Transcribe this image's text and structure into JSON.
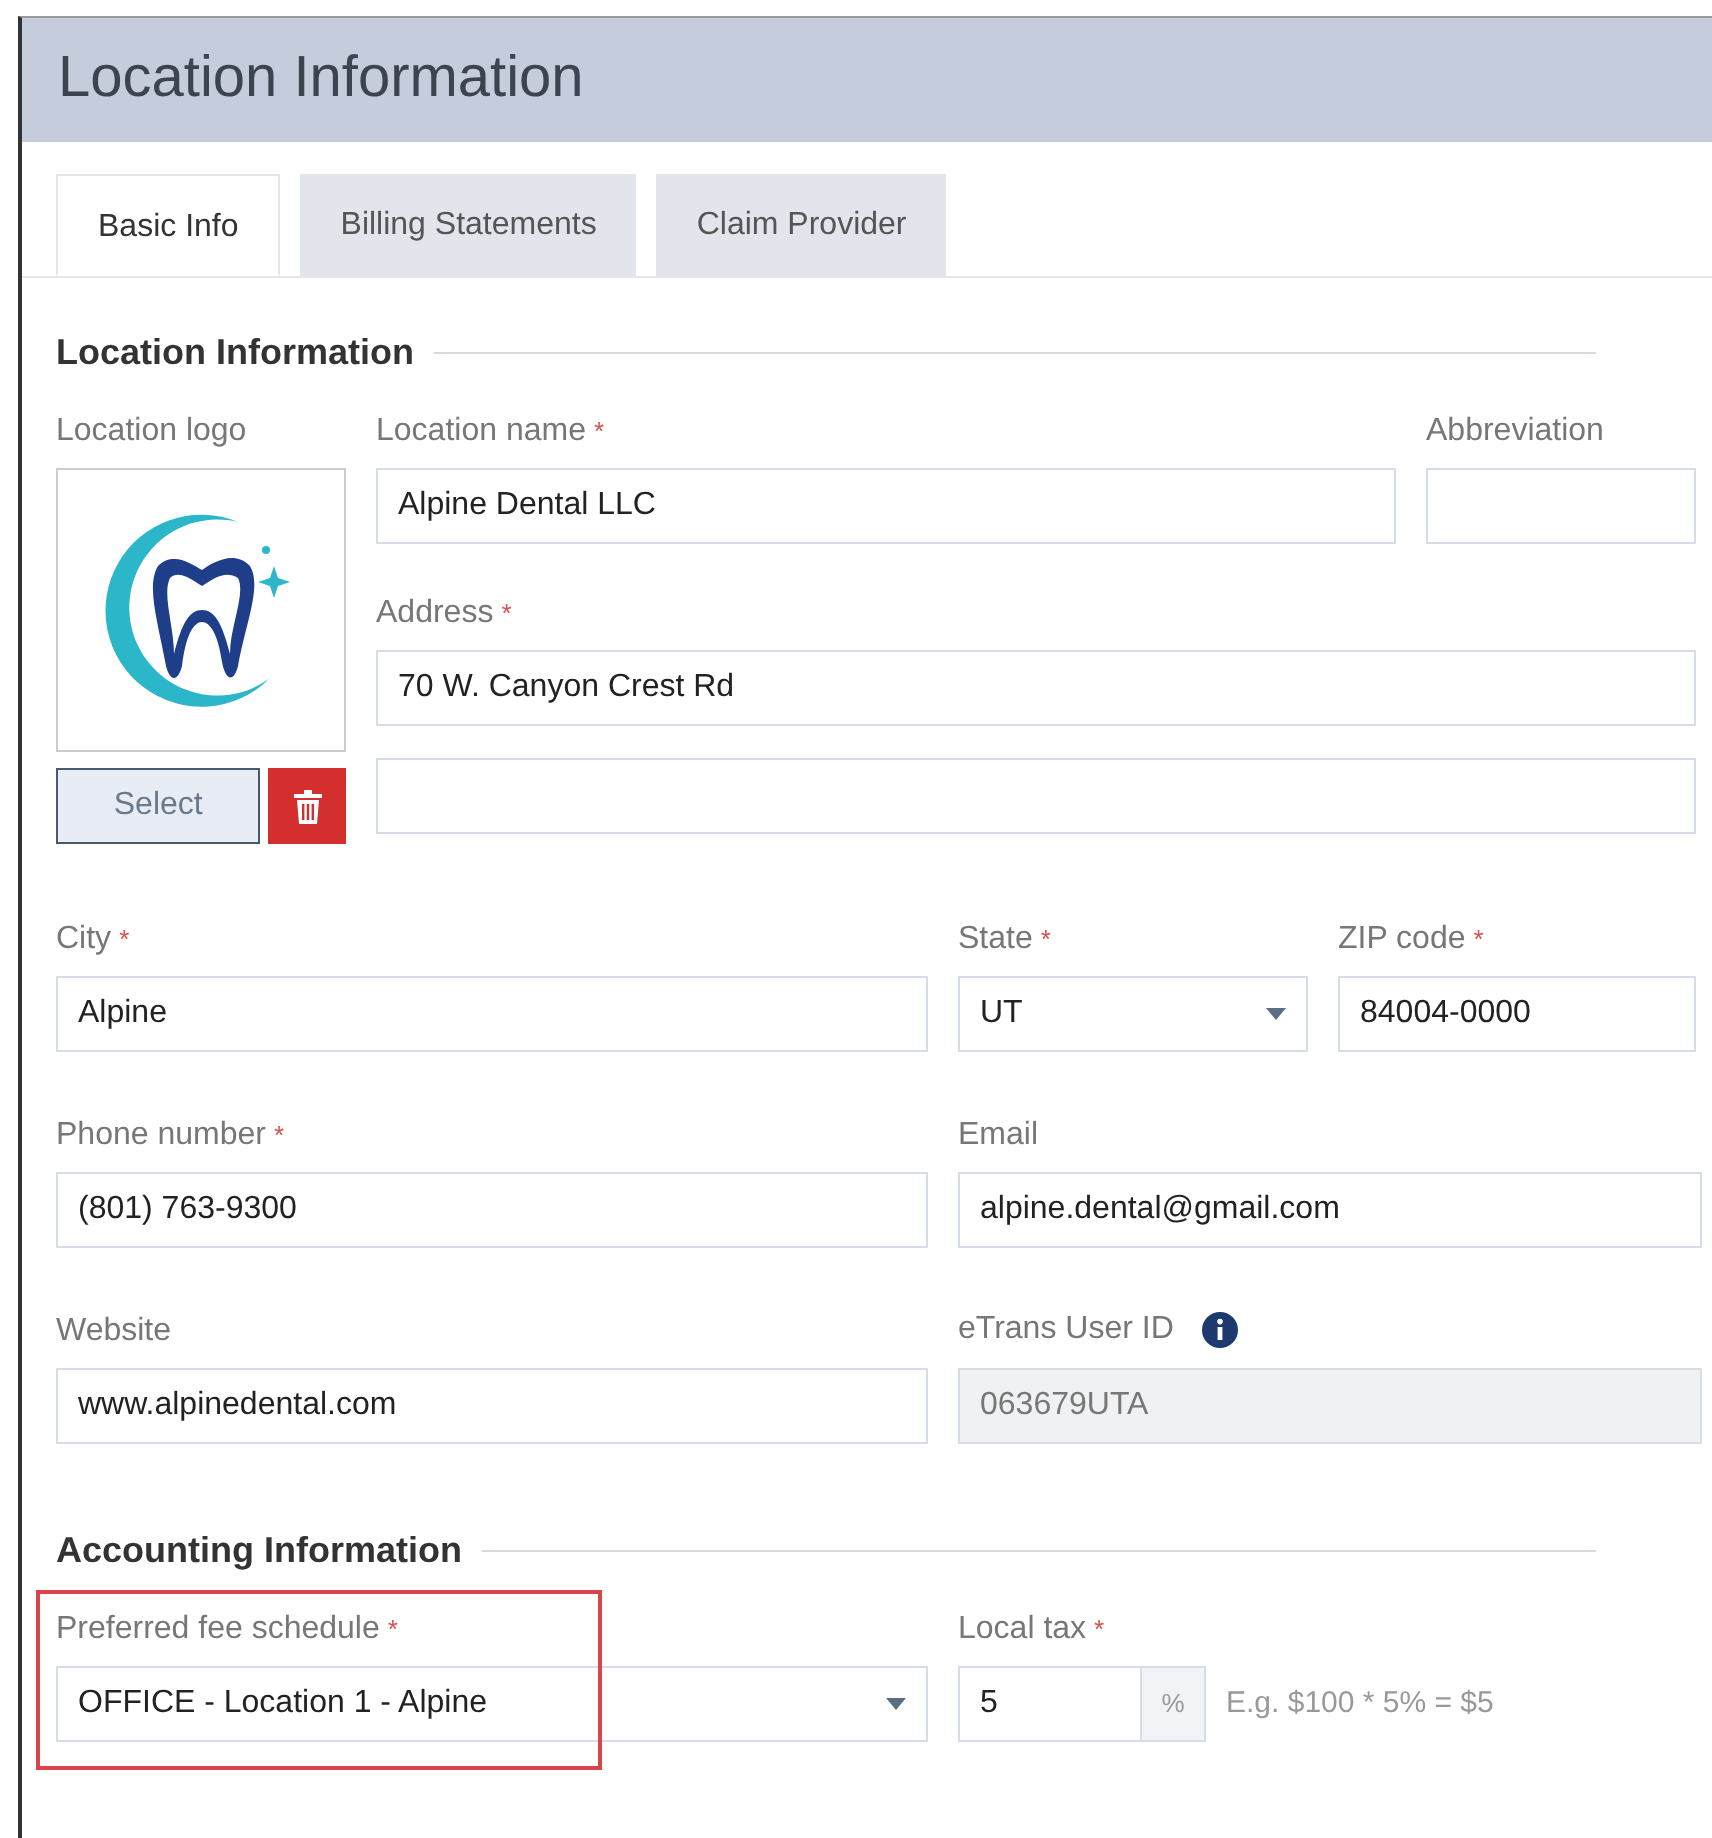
{
  "header": {
    "title": "Location Information"
  },
  "tabs": [
    {
      "label": "Basic Info",
      "selected": true
    },
    {
      "label": "Billing Statements",
      "selected": false
    },
    {
      "label": "Claim Provider",
      "selected": false
    }
  ],
  "location_section": {
    "heading": "Location Information",
    "logo": {
      "label": "Location logo",
      "select_button": "Select"
    },
    "location_name": {
      "label": "Location name",
      "required_mark": "*",
      "value": "Alpine Dental LLC"
    },
    "abbreviation": {
      "label": "Abbreviation"
    },
    "address": {
      "label": "Address",
      "required_mark": "*",
      "value": "70 W. Canyon Crest Rd"
    },
    "city": {
      "label": "City",
      "required_mark": "*",
      "value": "Alpine"
    },
    "state": {
      "label": "State",
      "required_mark": "*",
      "value": "UT"
    },
    "zip_code": {
      "label": "ZIP code",
      "required_mark": "*",
      "value": "84004-0000"
    },
    "phone_number": {
      "label": "Phone number",
      "required_mark": "*",
      "value": "(801) 763-9300"
    },
    "email": {
      "label": "Email",
      "value": "alpine.dental@gmail.com"
    },
    "website": {
      "label": "Website",
      "value": "www.alpinedental.com"
    },
    "etrans_user_id": {
      "label": "eTrans User ID",
      "value": "063679UTA",
      "disabled": true
    }
  },
  "accounting_section": {
    "heading": "Accounting Information",
    "preferred_fee_schedule": {
      "label": "Preferred fee schedule",
      "required_mark": "*",
      "value": "OFFICE - Location 1 - Alpine",
      "highlighted": true
    },
    "local_tax": {
      "label": "Local tax",
      "required_mark": "*",
      "value": "5",
      "unit": "%",
      "hint": "E.g. $100 * 5% = $5"
    }
  }
}
